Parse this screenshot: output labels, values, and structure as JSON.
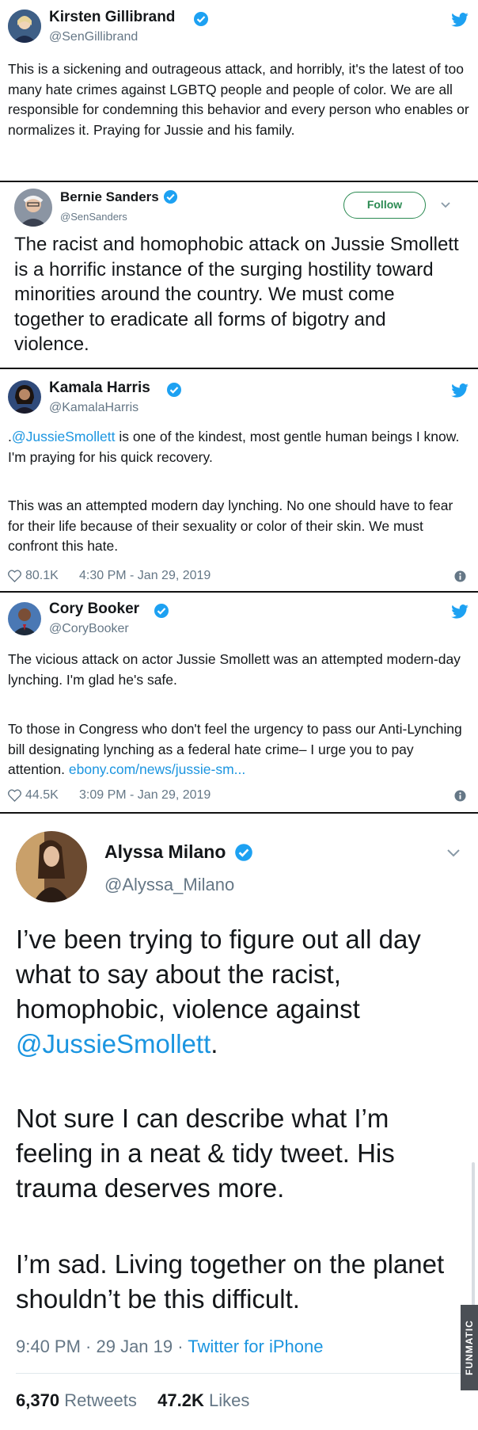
{
  "colors": {
    "accent": "#1da1f2",
    "link": "#1b95e0",
    "muted": "#657786",
    "divider": "#111111"
  },
  "tweets": {
    "gillibrand": {
      "name": "Kirsten Gillibrand",
      "handle": "@SenGillibrand",
      "text": "This is a sickening and outrageous attack, and horribly, it's the latest of too many hate crimes against LGBTQ people and people of color. We are all responsible for condemning this behavior and every person who enables or normalizes it. Praying for Jussie and his family."
    },
    "sanders": {
      "name": "Bernie Sanders",
      "handle": "@SenSanders",
      "follow_label": "Follow",
      "text": "The racist and homophobic attack on Jussie Smollett is a horrific instance of the surging hostility toward minorities around the country. We must come together to eradicate all forms of bigotry and violence."
    },
    "harris": {
      "name": "Kamala Harris",
      "handle": "@KamalaHarris",
      "text_prefix": ".",
      "mention": "@JussieSmollett",
      "text_rest": " is one of the kindest, most gentle human beings I know. I'm praying for his quick recovery.",
      "text2": "This was an attempted modern day lynching. No one should have to fear for their life because of their sexuality or color of their skin. We must confront this hate.",
      "likes": "80.1K",
      "timestamp": "4:30 PM - Jan 29, 2019"
    },
    "booker": {
      "name": "Cory Booker",
      "handle": "@CoryBooker",
      "text1": "The vicious attack on actor Jussie Smollett was an attempted modern-day lynching. I'm glad he's safe.",
      "text2": "To those in Congress who don't feel the urgency to pass our Anti-Lynching bill designating lynching as a federal hate crime– I urge you to pay attention. ",
      "link": "ebony.com/news/jussie-sm...",
      "likes": "44.5K",
      "timestamp": "3:09 PM - Jan 29, 2019"
    },
    "milano": {
      "name": "Alyssa Milano",
      "handle": "@Alyssa_Milano",
      "text1": "I’ve been trying to figure out all day what to say about the racist, homophobic, violence against ",
      "mention": "@JussieSmollett",
      "text1_end": ".",
      "text2": "Not sure I can describe what I’m feeling in a neat & tidy tweet. His trauma deserves more.",
      "text3": "I’m sad. Living together on the planet shouldn’t be this difficult.",
      "time": "9:40 PM · 29 Jan 19 · ",
      "source": "Twitter for iPhone",
      "retweets_count": "6,370",
      "retweets_label": "Retweets",
      "likes_count": "47.2K",
      "likes_label": "Likes"
    }
  },
  "watermark": "FUNMATIC"
}
